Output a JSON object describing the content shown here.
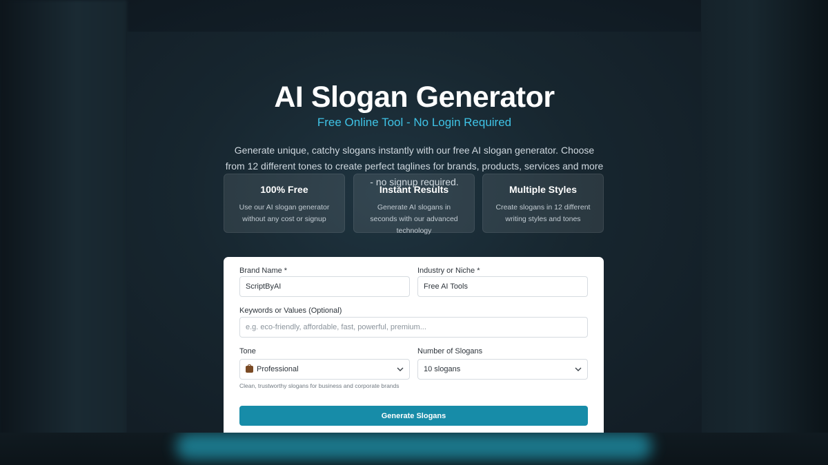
{
  "header": {
    "title": "AI Slogan Generator",
    "subtitle": "Free Online Tool - No Login Required",
    "intro": "Generate unique, catchy slogans instantly with our free AI slogan generator. Choose from 12 different tones to create perfect taglines for brands, products, services and more - no signup required."
  },
  "features": [
    {
      "title": "100% Free",
      "description": "Use our AI slogan generator without any cost or signup"
    },
    {
      "title": "Instant Results",
      "description": "Generate AI slogans in seconds with our advanced technology"
    },
    {
      "title": "Multiple Styles",
      "description": "Create slogans in 12 different writing styles and tones"
    }
  ],
  "form": {
    "brand_name": {
      "label": "Brand Name *",
      "value": "ScriptByAI"
    },
    "industry": {
      "label": "Industry or Niche *",
      "value": "Free AI Tools"
    },
    "keywords": {
      "label": "Keywords or Values (Optional)",
      "placeholder": "e.g. eco-friendly, affordable, fast, powerful, premium..."
    },
    "tone": {
      "label": "Tone",
      "selected": "Professional",
      "icon": "briefcase-icon",
      "hint": "Clean, trustworthy slogans for business and corporate brands"
    },
    "count": {
      "label": "Number of Slogans",
      "selected": "10 slogans"
    },
    "submit_label": "Generate Slogans"
  },
  "colors": {
    "accent": "#3fc3e6",
    "button": "#178ca8",
    "panel_bg": "#17262f"
  }
}
